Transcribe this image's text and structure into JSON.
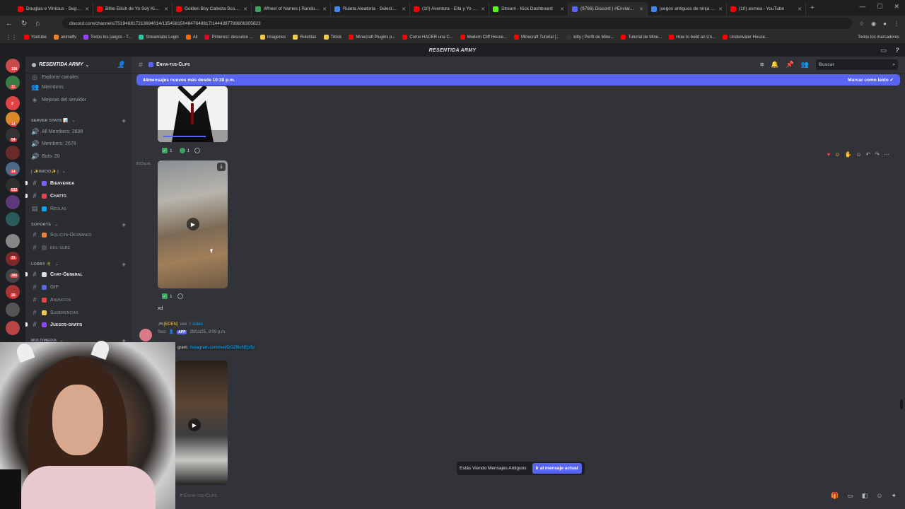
{
  "browser": {
    "tabs": [
      {
        "title": "Douglas e Vinícius - Segundo...",
        "color": "#ff0000"
      },
      {
        "title": "Billie Eilish de Yo Soy Kids ro...",
        "color": "#ff0000"
      },
      {
        "title": "Golden Boy Cabeza Scott Hib...",
        "color": "#ff0000"
      },
      {
        "title": "Wheel of Names | Random na...",
        "color": "#3ba55d"
      },
      {
        "title": "Ruleta Aleatoria - Selector R...",
        "color": "#4285f4"
      },
      {
        "title": "(10) Aventura - Ella y Yo (ft. D...",
        "color": "#ff0000"
      },
      {
        "title": "Stream - Kick Dashboard",
        "color": "#53fc18"
      },
      {
        "title": "(9766) Discord | #Enviar...",
        "color": "#5865f2"
      },
      {
        "title": "juegos antiguos de ninja - Bús...",
        "color": "#4285f4"
      },
      {
        "title": "(10) asmea - YouTube",
        "color": "#ff0000"
      }
    ],
    "new_tab": "+",
    "url": "discord.com/channels/751946817213694014/1354581504847648817/1444387789606305823",
    "bookmarks": [
      {
        "label": "Youtube",
        "color": "#ff0000"
      },
      {
        "label": "animeflv",
        "color": "#f08030"
      },
      {
        "label": "Todos los juegos - T...",
        "color": "#9146ff"
      },
      {
        "label": "Streamlabs Login",
        "color": "#31c3a2"
      },
      {
        "label": "Ali",
        "color": "#ff6a00"
      },
      {
        "label": "Pinterest: descubre ...",
        "color": "#e60023"
      },
      {
        "label": "Imagenes",
        "color": "#f2c94c"
      },
      {
        "label": "Ruletitas",
        "color": "#f2c94c"
      },
      {
        "label": "Tiktok",
        "color": "#f2c94c"
      },
      {
        "label": "Minecraft Plugins p...",
        "color": "#ff0000"
      },
      {
        "label": "Como HACER una C...",
        "color": "#ff0000"
      },
      {
        "label": "Modern Cliff House...",
        "color": "#ff0000"
      },
      {
        "label": "Minecraft Tutorial |...",
        "color": "#ff0000"
      },
      {
        "label": "kitty | Perfil de Mine...",
        "color": "#333333"
      },
      {
        "label": "Tutorial de Mine...",
        "color": "#ff0000"
      },
      {
        "label": "How to build an Un...",
        "color": "#ff0000"
      },
      {
        "label": "Underwater House...",
        "color": "#ff0000"
      }
    ],
    "all_bookmarks": "Todos los marcadores"
  },
  "discord": {
    "window_title": "RESENTIDA ARMY",
    "server_name": "RESENTIDA ARMY",
    "sidebar": {
      "top_items": [
        "Explorar canales",
        "Miembros",
        "Mejoras del servidor"
      ],
      "stats_category": "SERVER STATS 📊",
      "stats": [
        "All Members: 2698",
        "Members: 2678",
        "Bots: 20"
      ],
      "inicio_category": "| ✨INICIO✨ |",
      "inicio_channels": [
        "Bienvenida",
        "Chatto",
        "Reglas"
      ],
      "soporte_category": "SOPORTE",
      "soporte_channels": [
        "Solicita-Desbaneo",
        "rol-subs"
      ],
      "lobby_category": "LOBBY 🌴",
      "lobby_channels": [
        "Chat-General",
        "GIF",
        "Anuncios",
        "Sugerencias",
        "Juegos-gratis"
      ],
      "multimedia_category": "MULTIMEDIA"
    },
    "guild_badges": [
      "199",
      "11",
      "2",
      "14",
      "94",
      "14",
      "512",
      "31",
      "386",
      "36"
    ],
    "channel_header": "Envia-tus-Clips",
    "search_placeholder": "Buscar",
    "new_messages_bar": "44mensajes nuevos más desde 10:39 p.m.",
    "mark_read": "Marcar como leído",
    "messages": {
      "reaction1_count_a": "1",
      "reaction1_count_b": "1",
      "timestamp2": "8:53 p.m.",
      "reaction2_count": "1",
      "text_xd": "xd",
      "reply_meta_user": "🎮[EDEN]",
      "reply_meta_action": "usó",
      "reply_meta_link": "!! vídeo",
      "author": "Soci",
      "app_badge": "APP",
      "author_time": "29/11/25, 9:09 p.m.",
      "link_prefix": "gram:",
      "link_url": "instagram.com/reel/DOZf6cNEpSj/"
    },
    "old_messages_notice": "Estás Viendo Mensajes Antiguos",
    "jump_present": "Ir al mensaje actual",
    "input_placeholder": "# Envia-tus-Clips"
  }
}
